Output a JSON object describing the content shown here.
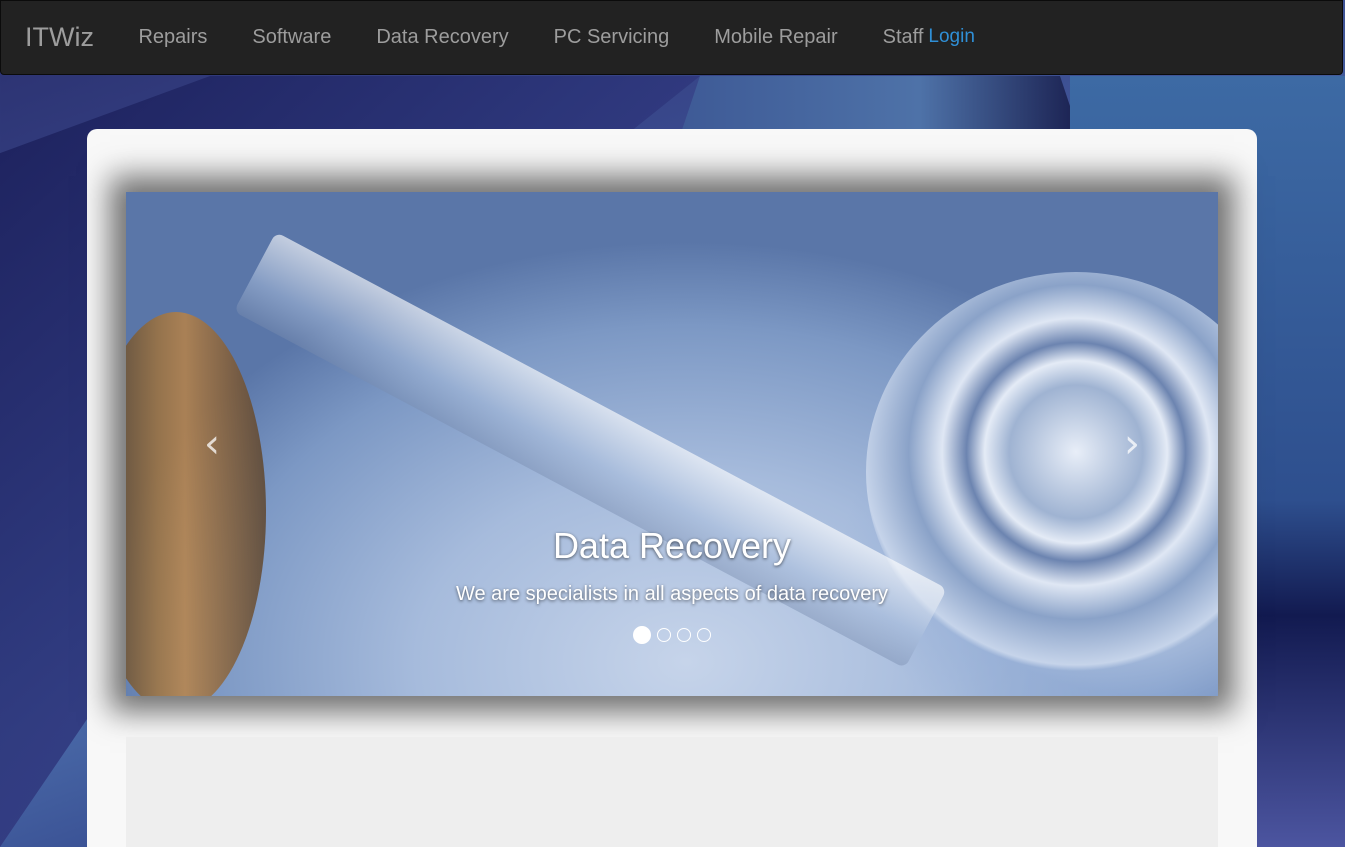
{
  "navbar": {
    "brand": "ITWiz",
    "items": [
      {
        "label": "Repairs"
      },
      {
        "label": "Software"
      },
      {
        "label": "Data Recovery"
      },
      {
        "label": "PC Servicing"
      },
      {
        "label": "Mobile Repair"
      },
      {
        "label": "Staff"
      }
    ],
    "login": "Login"
  },
  "carousel": {
    "prev_icon": "‹",
    "next_icon": "›",
    "slide_title": "Data Recovery",
    "slide_text": "We are specialists in all aspects of data recovery",
    "slide_count": 4,
    "active_index": 0
  },
  "colors": {
    "navbar_bg": "#222222",
    "nav_text": "#9d9d9d",
    "login_link": "#2f8fd6"
  }
}
